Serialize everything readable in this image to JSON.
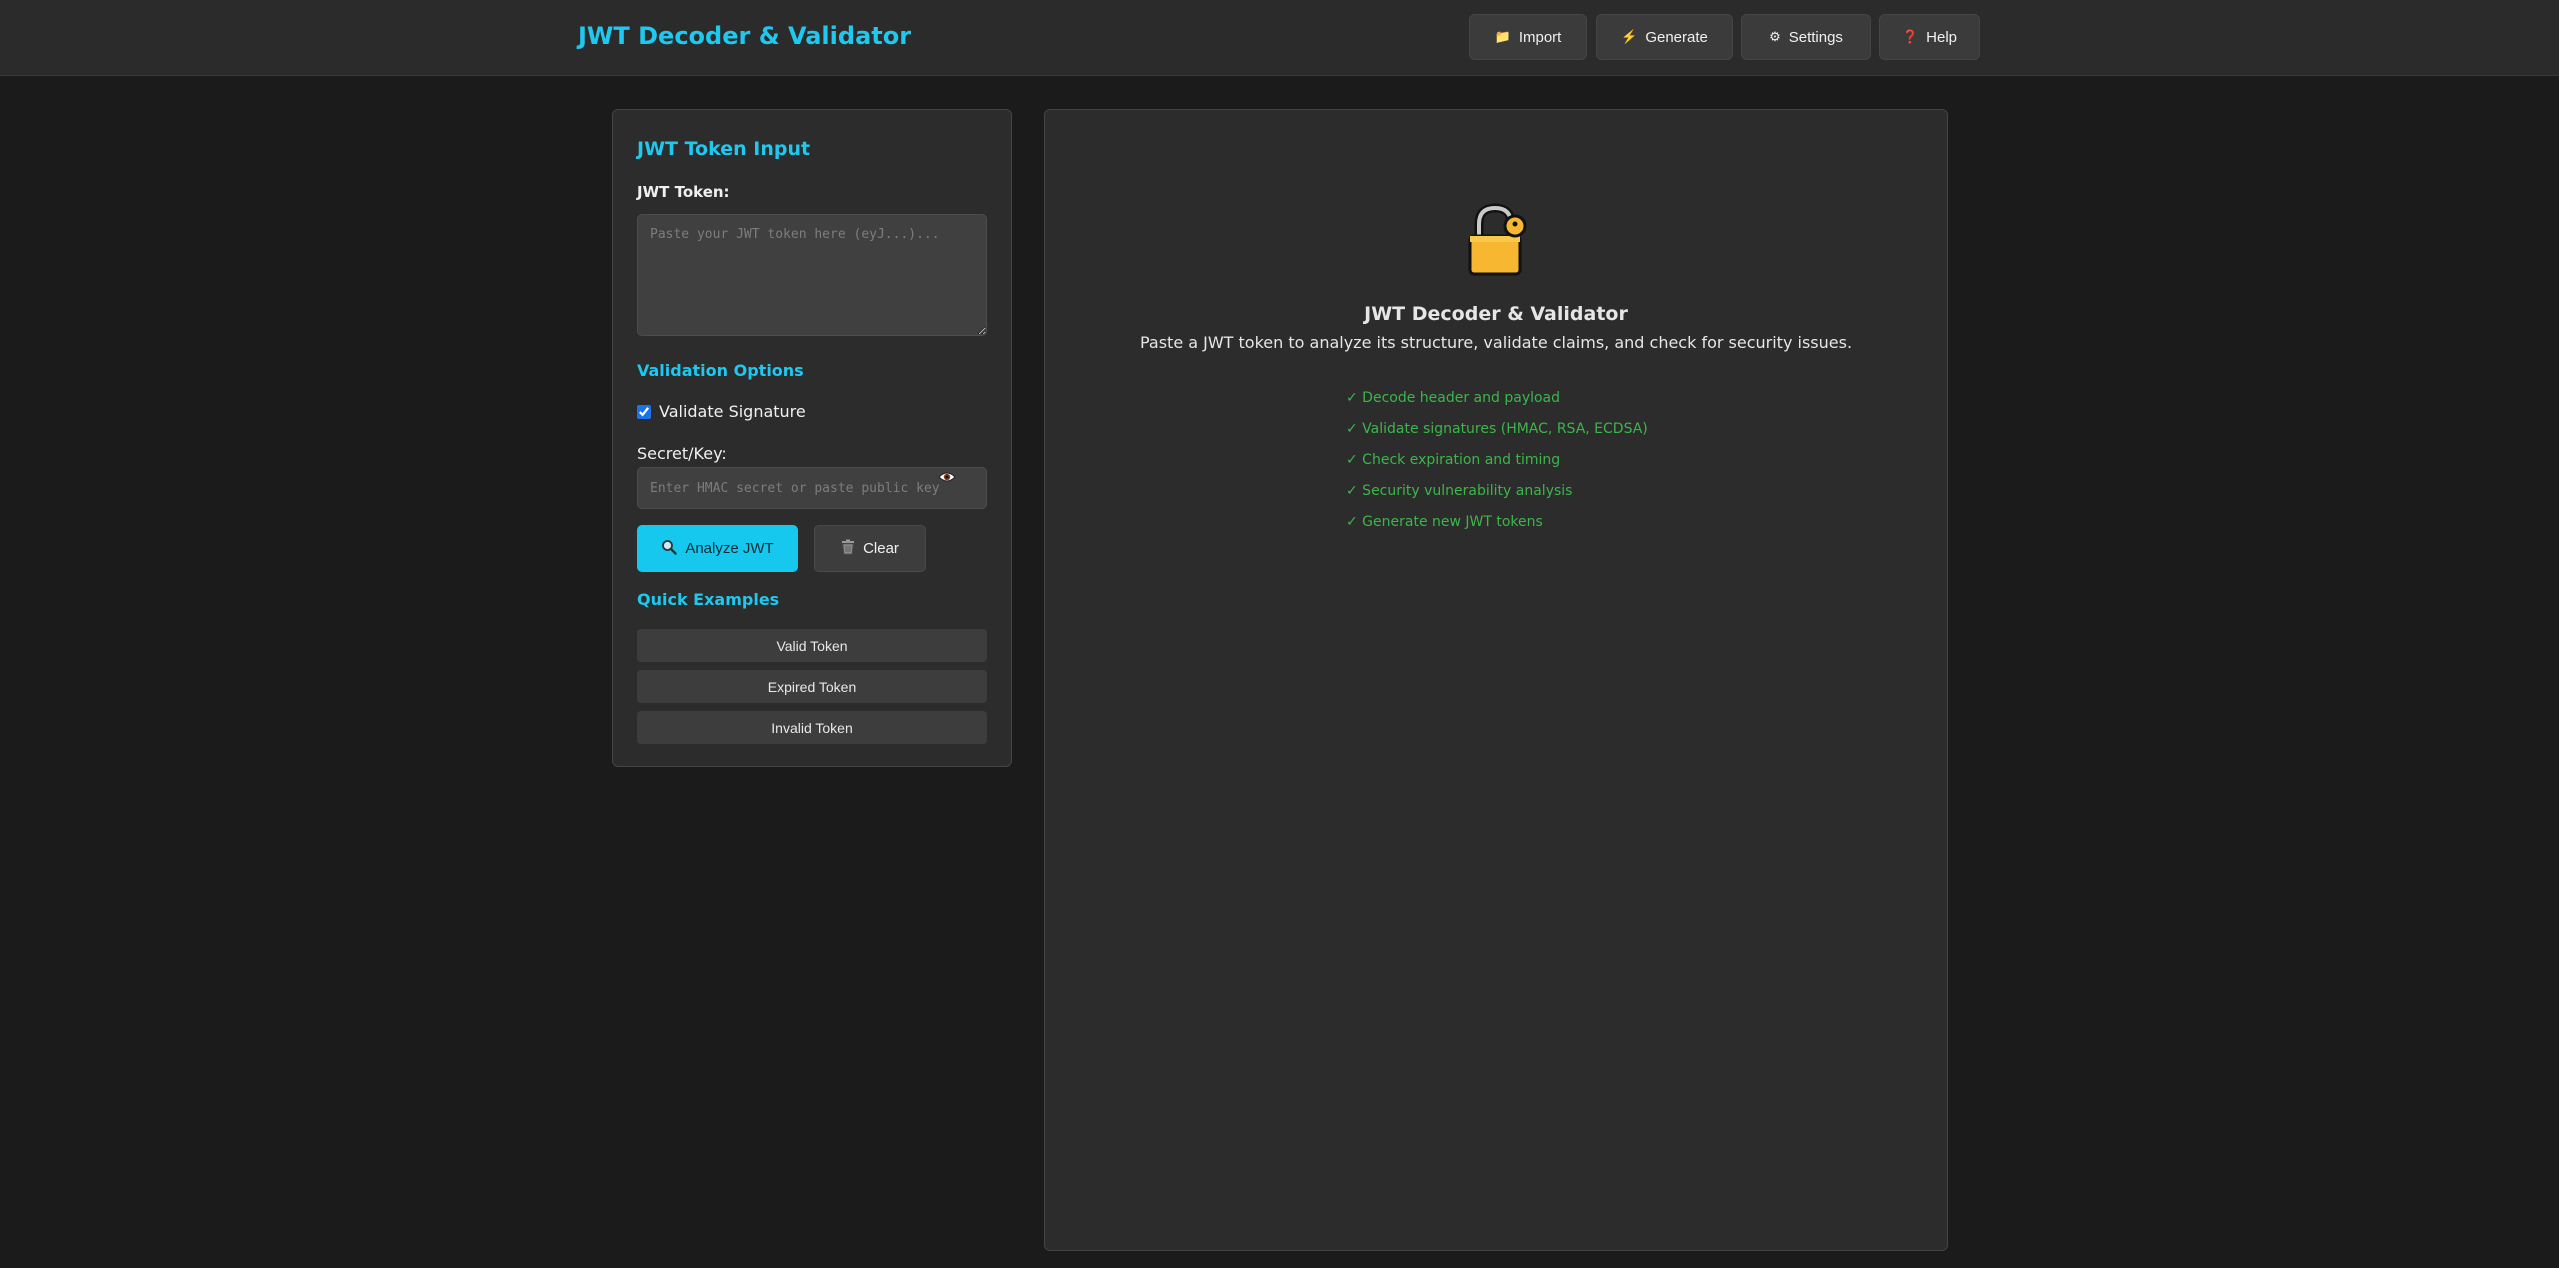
{
  "header": {
    "title": "JWT Decoder & Validator",
    "nav": [
      {
        "label": "Import",
        "icon": "folder-icon",
        "glyph": "📁"
      },
      {
        "label": "Generate",
        "icon": "lightning-icon",
        "glyph": "⚡"
      },
      {
        "label": "Settings",
        "icon": "gear-icon",
        "glyph": "⚙"
      },
      {
        "label": "Help",
        "icon": "question-icon",
        "glyph": "❓"
      }
    ]
  },
  "input_panel": {
    "title": "JWT Token Input",
    "token_label": "JWT Token:",
    "token_placeholder": "Paste your JWT token here (eyJ...)...",
    "token_value": "",
    "options_title": "Validation Options",
    "validate_signature_label": "Validate Signature",
    "validate_signature_checked": true,
    "secret_label": "Secret/Key:",
    "secret_placeholder": "Enter HMAC secret or paste public key",
    "secret_value": "",
    "analyze_label": "Analyze JWT",
    "analyze_icon": "magnifier-icon",
    "clear_label": "Clear",
    "clear_icon": "trash-icon",
    "examples_title": "Quick Examples",
    "examples": [
      "Valid Token",
      "Expired Token",
      "Invalid Token"
    ]
  },
  "welcome": {
    "icon": "padlock-icon",
    "title": "JWT Decoder & Validator",
    "subtitle": "Paste a JWT token to analyze its structure, validate claims, and check for security issues.",
    "features": [
      "✓ Decode header and payload",
      "✓ Validate signatures (HMAC, RSA, ECDSA)",
      "✓ Check expiration and timing",
      "✓ Security vulnerability analysis",
      "✓ Generate new JWT tokens"
    ]
  },
  "colors": {
    "accent": "#1ec8ee",
    "feature_green": "#3cb64a",
    "background": "#1b1b1b",
    "panel": "#2c2c2c"
  }
}
